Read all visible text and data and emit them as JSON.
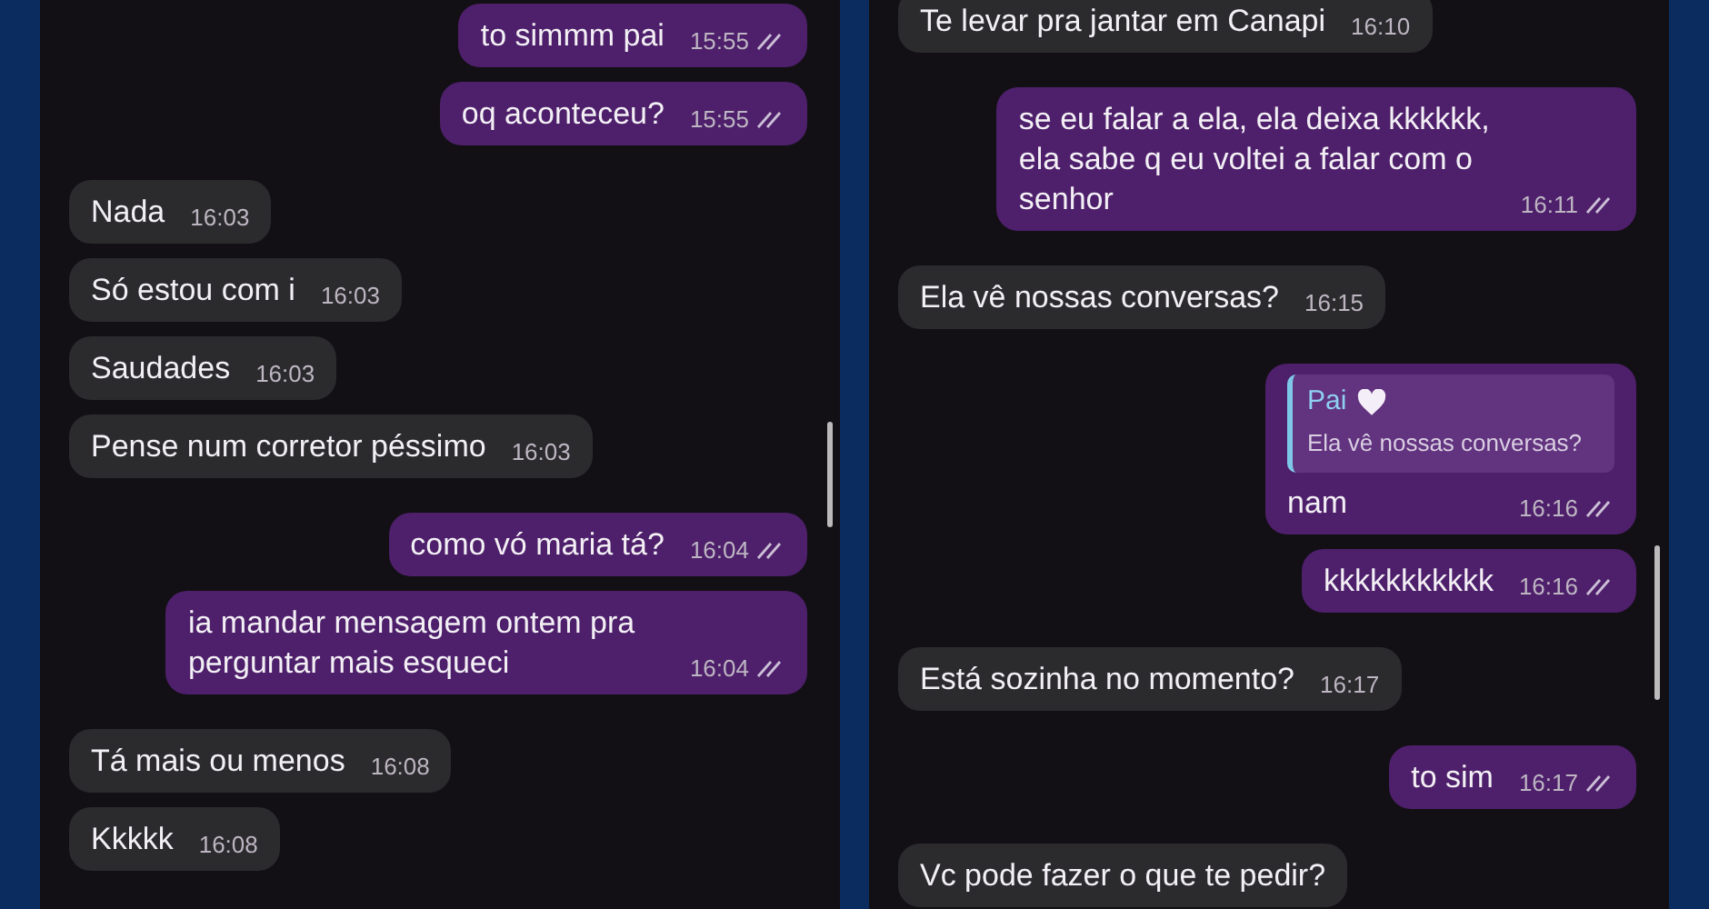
{
  "panels": [
    {
      "messages": [
        {
          "kind": "sent",
          "text": "to simmm pai",
          "time": "15:55",
          "read": true
        },
        {
          "kind": "sent",
          "text": "oq aconteceu?",
          "time": "15:55",
          "read": true
        },
        {
          "kind": "received",
          "text": "Nada",
          "time": "16:03"
        },
        {
          "kind": "received",
          "text": "Só estou com i",
          "time": "16:03"
        },
        {
          "kind": "received",
          "text": "Saudades",
          "time": "16:03"
        },
        {
          "kind": "received",
          "text": "Pense num corretor péssimo",
          "time": "16:03"
        },
        {
          "kind": "sent",
          "text": "como vó maria tá?",
          "time": "16:04",
          "read": true
        },
        {
          "kind": "sent",
          "text": "ia mandar mensagem ontem pra perguntar mais esqueci",
          "time": "16:04",
          "read": true
        },
        {
          "kind": "received",
          "text": "Tá mais ou menos",
          "time": "16:08"
        },
        {
          "kind": "received",
          "text": "Kkkkk",
          "time": "16:08"
        }
      ]
    },
    {
      "messages": [
        {
          "kind": "received",
          "text": "Te levar pra jantar em Canapi",
          "time": "16:10"
        },
        {
          "kind": "sent",
          "text": "se eu falar a ela, ela deixa kkkkkk, ela sabe q eu voltei a falar com o senhor",
          "time": "16:11",
          "read": true
        },
        {
          "kind": "received",
          "text": "Ela vê nossas conversas?",
          "time": "16:15"
        },
        {
          "kind": "sent",
          "text": "nam",
          "time": "16:16",
          "read": true,
          "reply": {
            "author": "Pai",
            "text": "Ela vê nossas conversas?"
          }
        },
        {
          "kind": "sent",
          "text": "kkkkkkkkkkk",
          "time": "16:16",
          "read": true
        },
        {
          "kind": "received",
          "text": "Está sozinha no momento?",
          "time": "16:17"
        },
        {
          "kind": "sent",
          "text": "to sim",
          "time": "16:17",
          "read": true
        },
        {
          "kind": "received",
          "text": "Vc pode fazer o que te pedir?"
        }
      ]
    }
  ]
}
